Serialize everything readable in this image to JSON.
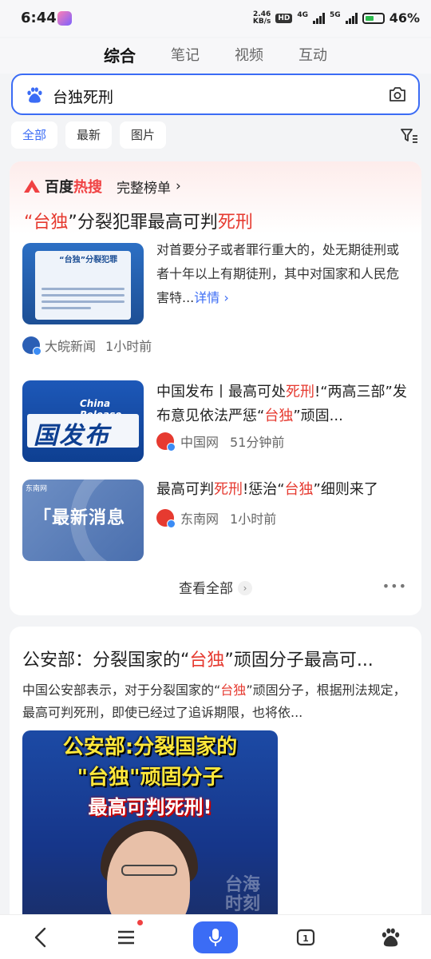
{
  "status_bar": {
    "time": "6:44",
    "speed_value": "2.46",
    "speed_unit": "KB/s",
    "hd": "HD",
    "net1": "4G",
    "net2": "5G",
    "battery": "46%"
  },
  "tabs": [
    "综合",
    "笔记",
    "视频",
    "互动"
  ],
  "search": {
    "query": "台独死刑"
  },
  "filters": [
    "全部",
    "最新",
    "图片"
  ],
  "hot_card": {
    "brand_a": "百度",
    "brand_b": "热搜",
    "full_list": "完整榜单",
    "title_pre": "“",
    "title_red1": "台独",
    "title_mid": "”分裂犯罪最高可判",
    "title_red2": "死刑",
    "items": [
      {
        "thumb_label": "“台独”分裂犯罪",
        "snippet": "对首要分子或者罪行重大的，处无期徒刑或者十年以上有期徒刑，其中对国家和人民危害特...",
        "more": "详情",
        "source": "大皖新闻",
        "time": "1小时前"
      },
      {
        "thumb_text": "China Release",
        "thumb_big": "国发布",
        "title_a": "中国发布丨最高可处",
        "title_red1": "死刑",
        "title_b": "!“两高三部”发布意见依法严惩“",
        "title_red2": "台独",
        "title_c": "”顽固...",
        "source": "中国网",
        "time": "51分钟前"
      },
      {
        "thumb_small": "东南网",
        "thumb_big": "「最新消息",
        "title_a": "最高可判",
        "title_red1": "死刑",
        "title_b": "!惩治“",
        "title_red2": "台独",
        "title_c": "”细则来了",
        "source": "东南网",
        "time": "1小时前"
      }
    ],
    "view_all": "查看全部"
  },
  "result2": {
    "title_a": "公安部：分裂国家的“",
    "title_red": "台独",
    "title_b": "”顽固分子最高可...",
    "snippet_a": "中国公安部表示，对于分裂国家的“",
    "snippet_red": "台独",
    "snippet_b": "”顽固分子，根据刑法规定，最高可判死刑，即使已经过了追诉期限，也将依...",
    "video_line1": "公安部:分裂国家的",
    "video_line2": "\"台独\"顽固分子",
    "video_line3": "最高可判死刑!",
    "watermark": "台海时刻"
  },
  "colors": {
    "accent": "#3b6cf5",
    "highlight": "#e63a30"
  },
  "icons": [
    "back-icon",
    "menu-icon",
    "mic-icon",
    "pages-icon",
    "baidu-paw-icon",
    "camera-icon",
    "filter-icon"
  ]
}
